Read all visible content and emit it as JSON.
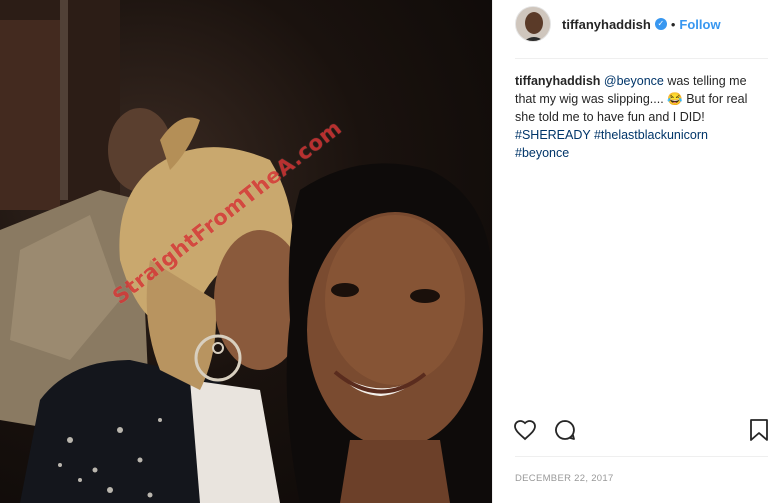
{
  "post": {
    "username": "tiffanyhaddish",
    "verified_symbol": "✓",
    "separator": "•",
    "follow_label": "Follow",
    "caption": {
      "username": "tiffanyhaddish",
      "mention": "@beyonce",
      "text_1": " was telling me that my wig was slipping.... ",
      "emoji": "😂",
      "text_2": " But for real she told me to have fun and I DID!",
      "hashtag_1": "#SHEREADY",
      "hashtag_2": "#thelastblackunicorn",
      "hashtag_3": "#beyonce"
    },
    "date": "December 22, 2017"
  },
  "photo": {
    "watermark": "StraightFromTheA.com"
  },
  "icons": {
    "like": "heart-icon",
    "comment": "comment-icon",
    "save": "bookmark-icon"
  },
  "colors": {
    "accent": "#3897f0",
    "link": "#003569",
    "watermark": "#d22828"
  }
}
